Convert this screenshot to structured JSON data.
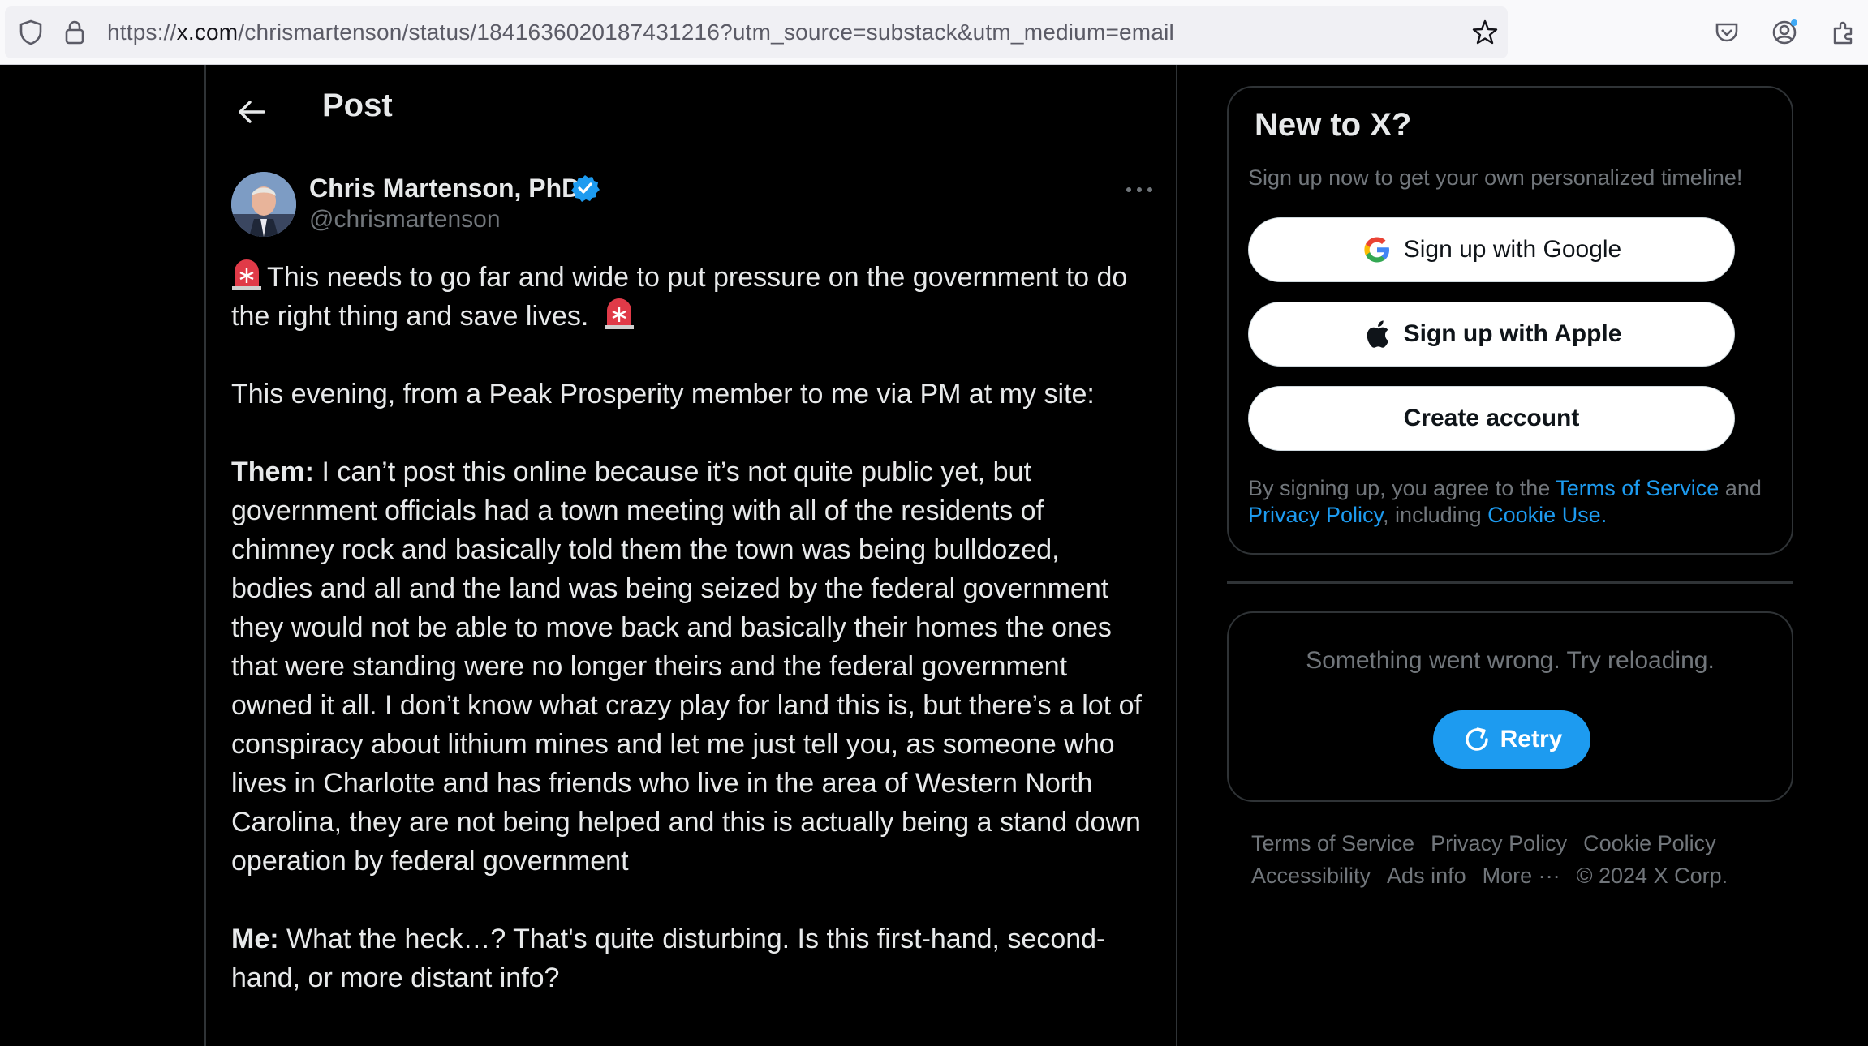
{
  "browser": {
    "url_prefix": "https://",
    "url_host": "x.com",
    "url_path": "/chrismartenson/status/1841636020187431216?utm_source=substack&utm_medium=email"
  },
  "header": {
    "title": "Post"
  },
  "author": {
    "name": "Chris Martenson, PhD",
    "handle": "@chrismartenson"
  },
  "tweet": {
    "intro": "This needs to go far and wide to put pressure on the government to do the right thing and save lives.",
    "line2": "This evening, from a Peak Prosperity member to me via PM at my site:",
    "them_label": "Them:",
    "them_text": "I can’t post this online because it’s not quite public yet, but government officials had a town meeting with all of the residents of chimney rock and basically told them the town was being bulldozed, bodies and all and the land was being seized by the federal government they would not be able to move back and basically their homes the ones that were standing were no longer theirs and the federal government owned it all. I don’t know what crazy play for land this is, but there’s a lot of conspiracy about lithium mines and let me just tell you, as someone who lives in Charlotte and has friends who live in the area of Western North Carolina, they are not being helped and this is actually being a stand down operation by federal government",
    "me_label": "Me:",
    "me_text": "What the heck…? That's quite disturbing. Is this first-hand, second-hand, or more distant info?"
  },
  "signup": {
    "title": "New to X?",
    "subtitle": "Sign up now to get your own personalized timeline!",
    "google_label": "Sign up with Google",
    "apple_label": "Sign up with Apple",
    "create_label": "Create account",
    "legal_prefix": "By signing up, you agree to the ",
    "terms_link": "Terms of Service",
    "legal_and": " and ",
    "privacy_link": "Privacy Policy",
    "legal_including": ", including ",
    "cookie_link": "Cookie Use."
  },
  "error_card": {
    "message": "Something went wrong. Try reloading.",
    "retry_label": "Retry"
  },
  "footer": {
    "links": [
      "Terms of Service",
      "Privacy Policy",
      "Cookie Policy",
      "Accessibility",
      "Ads info",
      "More ···",
      "© 2024 X Corp."
    ]
  },
  "colors": {
    "background": "#000000",
    "text": "#e7e9ea",
    "muted": "#71767b",
    "accent": "#1d9bf0",
    "border": "#2f3336"
  }
}
